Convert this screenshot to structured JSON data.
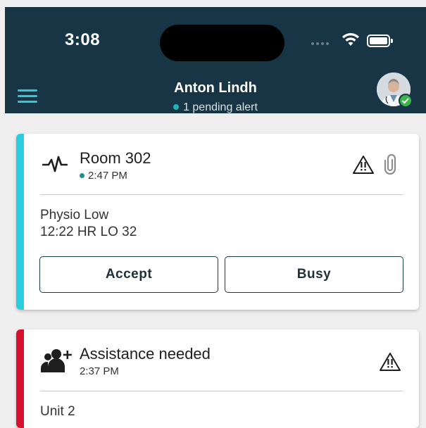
{
  "status_bar": {
    "time": "3:08"
  },
  "header": {
    "title": "Anton Lindh",
    "subtitle": "1 pending alert"
  },
  "alerts": [
    {
      "title": "Room 302",
      "time": "2:47 PM",
      "icon": "heartbeat-icon",
      "details": [
        "Physio Low",
        "12:22 HR LO 32"
      ],
      "accent": "#2ccde0",
      "actions": {
        "accept": "Accept",
        "busy": "Busy"
      }
    },
    {
      "title": "Assistance needed",
      "time": "2:37 PM",
      "icon": "add-user-icon",
      "details": [
        "Unit 2"
      ],
      "accent": "#d8102c"
    }
  ],
  "colors": {
    "header_bg": "#173545",
    "accent_teal": "#35c6d6",
    "online_green": "#39b54a"
  }
}
